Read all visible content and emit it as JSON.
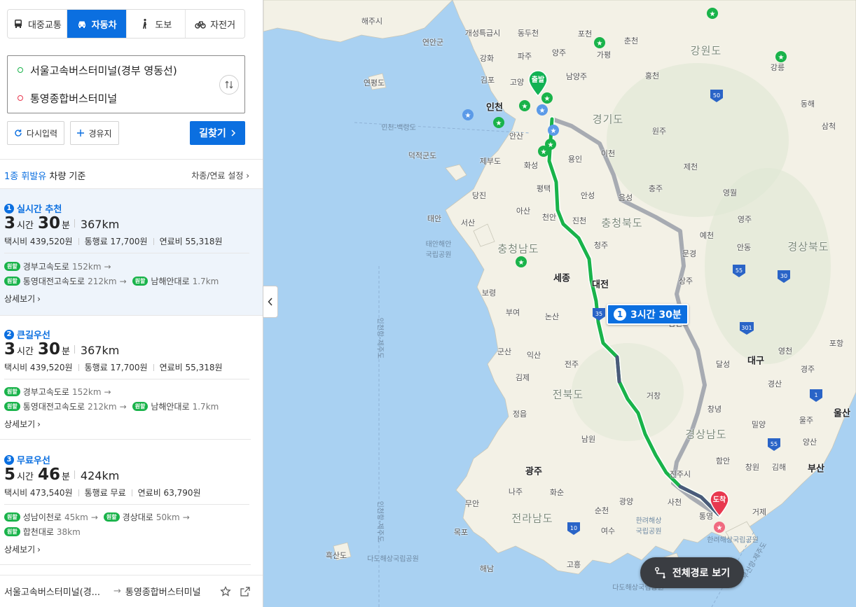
{
  "modes": [
    {
      "label": "대중교통",
      "icon": "bus-icon",
      "active": false
    },
    {
      "label": "자동차",
      "icon": "car-icon",
      "active": true
    },
    {
      "label": "도보",
      "icon": "walk-icon",
      "active": false
    },
    {
      "label": "자전거",
      "icon": "bicycle-icon",
      "active": false
    }
  ],
  "route": {
    "start": "서울고속버스터미널(경부 영동선)",
    "end": "통영종합버스터미널"
  },
  "buttons": {
    "reset": "다시입력",
    "waypoint": "경유지",
    "search": "길찾기"
  },
  "vehicle": {
    "basis_highlight": "1종 휘발유",
    "basis_rest": " 차량 기준",
    "setting": "차종/연료 설정"
  },
  "routes": [
    {
      "num": "1",
      "title": "실시간 추천",
      "hours": "3",
      "hour_unit": "시간",
      "minutes": "30",
      "min_unit": "분",
      "distance": "367km",
      "taxi": "택시비 439,520원",
      "toll": "통행료 17,700원",
      "fuel": "연료비 55,318원",
      "badge": "원할",
      "r1": "경부고속도로",
      "r1km": "152km",
      "r2": "통영대전고속도로",
      "r2km": "212km",
      "r3": "남해안대로",
      "r3km": "1.7km",
      "detail": "상세보기"
    },
    {
      "num": "2",
      "title": "큰길우선",
      "hours": "3",
      "hour_unit": "시간",
      "minutes": "30",
      "min_unit": "분",
      "distance": "367km",
      "taxi": "택시비 439,520원",
      "toll": "통행료 17,700원",
      "fuel": "연료비 55,318원",
      "badge": "원할",
      "r1": "경부고속도로",
      "r1km": "152km",
      "r2": "통영대전고속도로",
      "r2km": "212km",
      "r3": "남해안대로",
      "r3km": "1.7km",
      "detail": "상세보기"
    },
    {
      "num": "3",
      "title": "무료우선",
      "hours": "5",
      "hour_unit": "시간",
      "minutes": "46",
      "min_unit": "분",
      "distance": "424km",
      "taxi": "택시비 473,540원",
      "toll": "통행료 무료",
      "fuel": "연료비 63,790원",
      "badge": "원할",
      "r1": "성남이천로",
      "r1km": "45km",
      "r2": "경상대로",
      "r2km": "50km",
      "r3": "합천대로",
      "r3km": "38km",
      "detail": "상세보기"
    }
  ],
  "footer": {
    "from": "서울고속버스터미널(경...",
    "to": "통영종합버스터미널"
  },
  "map": {
    "bubble_num": "1",
    "bubble_time": "3시간 30분",
    "start_pin": "출발",
    "end_pin": "도착",
    "full_route": "전체경로 보기",
    "labels": {
      "haeju": "해주시",
      "gaeseong": "개성특급시",
      "dongducheon": "동두천",
      "yeonan": "연안군",
      "pocheon": "포천",
      "chuncheon": "춘천",
      "gangwon": "강원도",
      "ganghwa": "강화",
      "paju": "파주",
      "yangju": "양주",
      "gapyeong": "가평",
      "gangneung": "강릉",
      "yeonpyeong": "연평도",
      "gimpo": "김포",
      "goyang": "고양",
      "namyangju": "남양주",
      "hongcheon": "홍천",
      "incheon": "인천",
      "gyeonggi": "경기도",
      "donghae": "동해",
      "ansan": "안산",
      "wonju": "원주",
      "samcheok": "삼척",
      "incheon_baeknyeong": "인천-백령도",
      "icheon": "이천",
      "deokjeok": "덕적군도",
      "hwaseong": "화성",
      "yongin": "용인",
      "jecheon": "제천",
      "jebudo": "제부도",
      "pyeongtaek": "평택",
      "chungju": "충주",
      "dangjin": "당진",
      "anseong": "안성",
      "eumseong": "음성",
      "yeongwol": "영월",
      "taean": "태안",
      "seosan": "서산",
      "asan": "아산",
      "cheonan": "천안",
      "jincheon": "진천",
      "chungbuk": "충청북도",
      "yecheon": "예천",
      "yeongju": "영주",
      "taean_park": "태안해안 국립공원",
      "cheongju": "청주",
      "mungyeong": "문경",
      "chungnam": "충청남도",
      "andong": "안동",
      "gyeongbuk": "경상북도",
      "sejong": "세종",
      "daejeon": "대전",
      "boryeong": "보령",
      "sangju": "상주",
      "buyeo": "부여",
      "nonsan": "논산",
      "gimcheon": "김천",
      "pohang": "포항",
      "yeongcheon": "영천",
      "gunsan": "군산",
      "iksan": "익산",
      "jeonju": "전주",
      "dalseong": "달성",
      "daegu": "대구",
      "gyeongju": "경주",
      "gimje": "김제",
      "gyeongsan": "경산",
      "jeonbuk": "전북도",
      "geochang": "거창",
      "changnyeong": "창녕",
      "ulsan": "울산",
      "jeongeup": "정읍",
      "miryang": "밀양",
      "ulju": "울주",
      "gyeongnam": "경상남도",
      "yangsan": "양산",
      "namwon": "남원",
      "haman": "함안",
      "gwangju": "광주",
      "jinju": "진주시",
      "changwon": "창원",
      "gimhae": "김해",
      "busan": "부산",
      "naju": "나주",
      "hwasun": "화순",
      "muan": "무안",
      "gwangyang": "광양",
      "sacheon": "사천",
      "geoje": "거제",
      "jeonnam": "전라남도",
      "suncheon": "순천",
      "hallyeo": "한려해상 국립공원",
      "tongyeong": "통영",
      "mokpo": "목포",
      "yeosu": "여수",
      "heuksan": "흑산도",
      "dado": "다도해상국립공원",
      "goheung": "고흥",
      "haenam": "해남",
      "hallyeo2": "한려해상국립공원",
      "dado2": "다도해상국립공원",
      "incheon_jeju": "인천항-제주도",
      "incheon_jeju2": "인천항-제주도",
      "busan_jeju": "부산항-제주도"
    }
  }
}
